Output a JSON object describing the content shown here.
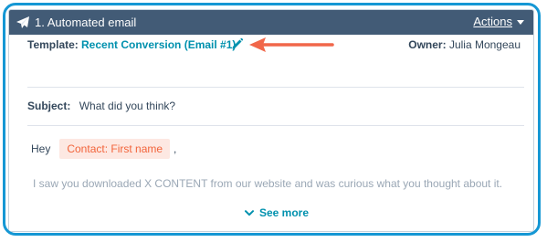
{
  "header": {
    "title": "1. Automated email",
    "actions_label": "Actions"
  },
  "template": {
    "label": "Template:",
    "value": "Recent Conversion (Email #1)"
  },
  "owner": {
    "label": "Owner:",
    "value": "Julia Mongeau"
  },
  "subject": {
    "label": "Subject:",
    "value": "What did you think?"
  },
  "email_body": {
    "greeting": "Hey",
    "token": "Contact: First name",
    "comma": ",",
    "preview": "I saw you downloaded X CONTENT from our website and was curious what you thought about it."
  },
  "see_more_label": "See more",
  "colors": {
    "frame_border": "#1597d4",
    "header_bg": "#425b76",
    "link": "#0091ae",
    "arrow": "#f1674a",
    "token_bg": "#fde8e2",
    "token_text": "#f2643b"
  },
  "icons": {
    "header": "paper-plane-icon",
    "edit": "pencil-icon",
    "expand": "chevron-down-icon",
    "annotation": "arrow-left-icon"
  }
}
